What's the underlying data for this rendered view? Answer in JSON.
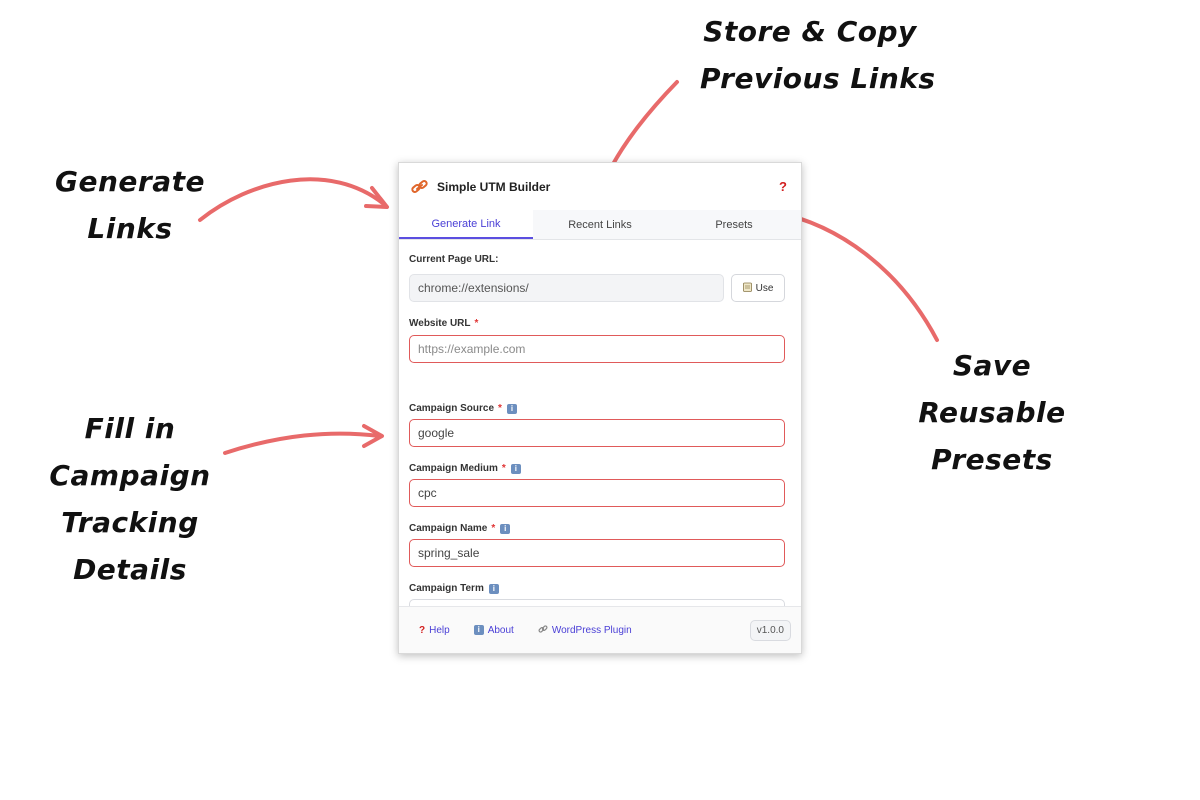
{
  "annotations": {
    "store_copy": [
      "Store & Copy",
      "Previous Links"
    ],
    "generate": [
      "Generate",
      "Links"
    ],
    "save_presets": [
      "Save",
      "Reusable",
      "Presets"
    ],
    "fill_in": [
      "Fill in",
      "Campaign",
      "Tracking",
      "Details"
    ]
  },
  "annotation_color": "#e86a6a",
  "app": {
    "title": "Simple UTM Builder",
    "help_icon": "?",
    "accent": "#5b4ee0"
  },
  "tabs": [
    {
      "label": "Generate Link",
      "active": true
    },
    {
      "label": "Recent Links",
      "active": false
    },
    {
      "label": "Presets",
      "active": false
    }
  ],
  "form": {
    "current_page": {
      "label": "Current Page URL:",
      "value": "chrome://extensions/",
      "use_label": "Use"
    },
    "website_url": {
      "label": "Website URL",
      "required": "*",
      "placeholder": "https://example.com"
    },
    "campaign_source": {
      "label": "Campaign Source",
      "required": "*",
      "info": "i",
      "value": "google"
    },
    "campaign_medium": {
      "label": "Campaign Medium",
      "required": "*",
      "info": "i",
      "value": "cpc"
    },
    "campaign_name": {
      "label": "Campaign Name",
      "required": "*",
      "info": "i",
      "value": "spring_sale"
    },
    "campaign_term": {
      "label": "Campaign Term",
      "info": "i"
    }
  },
  "footer": {
    "help": "Help",
    "help_icon": "?",
    "about": "About",
    "about_icon": "i",
    "wordpress": "WordPress Plugin",
    "version": "v1.0.0"
  }
}
